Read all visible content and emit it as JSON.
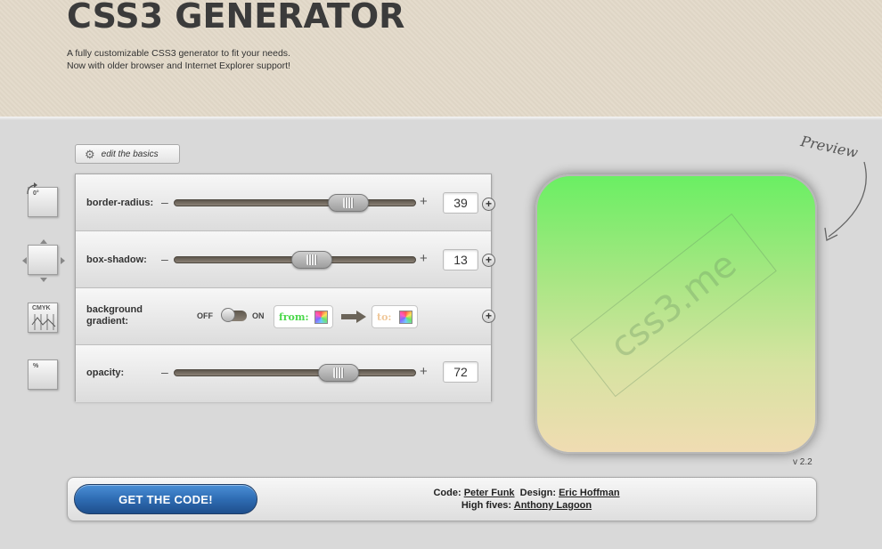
{
  "header": {
    "title": "CSS3 GENERATOR",
    "tagline_line1": "A fully customizable CSS3 generator to fit your needs.",
    "tagline_line2": "Now with older browser and Internet Explorer support!"
  },
  "toolbar": {
    "edit_basics_label": "edit the basics",
    "gear_icon": "gear-icon"
  },
  "side_icons": {
    "rotation_label": "0°",
    "gradient_label": "CMYK",
    "opacity_label": "%"
  },
  "controls": {
    "minus": "–",
    "plus": "+",
    "expand": "+",
    "border_radius": {
      "label": "border-radius:",
      "value": "39",
      "level": 0.72
    },
    "box_shadow": {
      "label": "box-shadow:",
      "value": "13",
      "level": 0.57
    },
    "gradient": {
      "label_line1": "background",
      "label_line2": "gradient:",
      "off_label": "OFF",
      "on_label": "ON",
      "from_label": "from:",
      "to_label": "to:"
    },
    "opacity": {
      "label": "opacity:",
      "value": "72",
      "level": 0.68
    }
  },
  "preview": {
    "label": "Preview",
    "watermark": "css3.me",
    "version": "v 2.2",
    "colors": {
      "top": "#6aef63",
      "bottom": "#f0dcb2"
    }
  },
  "footer": {
    "get_code_label": "GET THE CODE!",
    "code_prefix": "Code:",
    "code_author": "Peter Funk",
    "design_prefix": "Design:",
    "design_author": "Eric Hoffman",
    "highfives_prefix": "High fives:",
    "highfives_author": "Anthony Lagoon"
  },
  "colors": {
    "accent": "#2e6cb3",
    "from_text": "#4bd84b",
    "to_text": "#f0c89a"
  }
}
